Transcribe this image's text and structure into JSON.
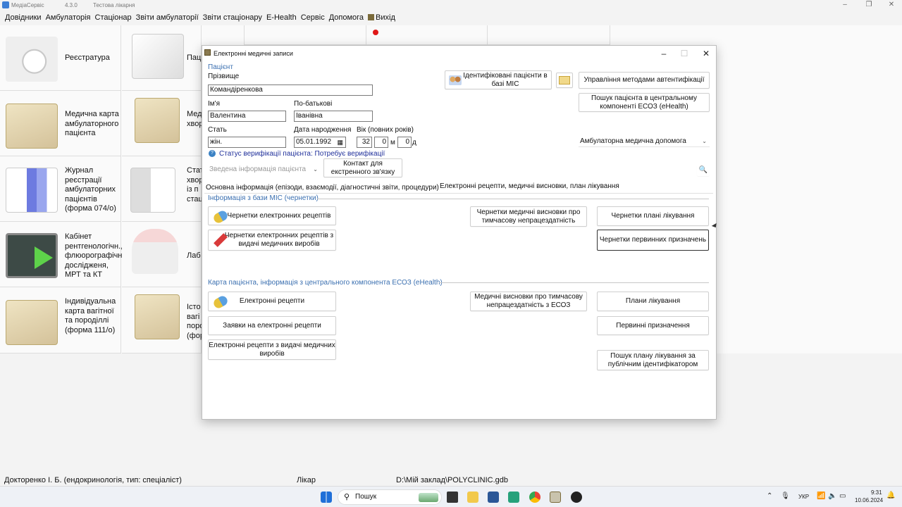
{
  "app": {
    "name": "МедіаСервіс",
    "version": "4.3.0",
    "db_label": "Тестова лікарня"
  },
  "menu": [
    "Довідники",
    "Амбулаторія",
    "Стаціонар",
    "Звіти амбулаторії",
    "Звіти стаціонару",
    "E-Health",
    "Сервіс",
    "Допомога",
    "Вихід"
  ],
  "tiles": {
    "registry": "Реєстратура",
    "outpatient_card": "Медична карта амбулаторного пацієнта",
    "journal": "Журнал реєстрації амбулаторних пацієнтів (форма 074/о)",
    "xray": "Кабінет рентгенологічн., флюорографічн. дослідженя, МРТ та КТ",
    "pregnancy": "Індивідуальна карта вагітної та породіллі (форма 111/о)",
    "col2_1": "Пац",
    "col2_2": "Мед хвор",
    "col2_3": "Стат хвор із п стац",
    "col2_4": "Лаб",
    "col2_5": "Істо вагі поро (фор"
  },
  "dialog": {
    "title": "Електронні медичні записи",
    "patient_section": "Пацієнт",
    "surname_label": "Прізвище",
    "surname": "Командіренкова",
    "name_label": "Ім'я",
    "name": "Валентина",
    "patronymic_label": "По-батькові",
    "patronymic": "Іванівна",
    "sex_label": "Стать",
    "sex": "жін.",
    "dob_label": "Дата народження",
    "dob": "05.01.1992",
    "age_label": "Вік (повних років)",
    "age_years": "32",
    "age_months": "0",
    "age_months_unit": "м",
    "age_days": "0",
    "age_days_unit": "д",
    "verification": "Статус верифікації пацієнта: Потребує верифікації",
    "summary_combo": "Зведена інформація пацієнта",
    "emergency_contact": "Контакт для екстренного зв'язку",
    "identified_patients": "Ідентифіковані пацієнти в базі МІС",
    "auth_methods": "Управління методами автентифікації",
    "search_central": "Пошук пацієнта в центральному компоненті ЕСОЗ (eHealth)",
    "care_type": "Амбулаторна медична допомога",
    "tab_main": "Основна інформація (епізоди, взаємодії, діагностичні звіти, процедури)",
    "tab_erecipes": "Електронні рецепти, медичні висновки, план лікування",
    "drafts_section": "Інформація з бази МІС (чернетки)",
    "draft_recipes": "Чернетки електронних рецептів",
    "draft_recipes_devices": "Чернетки електронних рецептів з видачі медичних виробів",
    "draft_disability": "Чернетки медичні висновки про тимчасову непрацездатність",
    "draft_plans": "Чернетки плані лікування",
    "draft_primary": "Чернетки первинних призначень",
    "central_section": "Карта пацієнта, інформація з центрального компонента ЕСОЗ (eHealth)",
    "erecipes": "Електронні рецепти",
    "recipe_requests": "Заявки на електронні рецепти",
    "recipes_devices": "Електронні рецепти з видачі медичних виробів",
    "disability_ecoz": "Медичні висновки про тимчасову непрацездатність з ЕСОЗ",
    "plans": "Плани лікування",
    "primary": "Первинні призначення",
    "search_plan": "Пошук плану лікування за публічним ідентифікатором"
  },
  "status": {
    "user": "Докторенко І. Б. (ендокринологія, тип: спеціаліст)",
    "role": "Лікар",
    "db_path": "D:\\Мій заклад\\POLYCLINIC.gdb"
  },
  "taskbar": {
    "search_placeholder": "Пошук",
    "lang": "УКР",
    "time": "9:31",
    "date": "10.06.2024"
  }
}
